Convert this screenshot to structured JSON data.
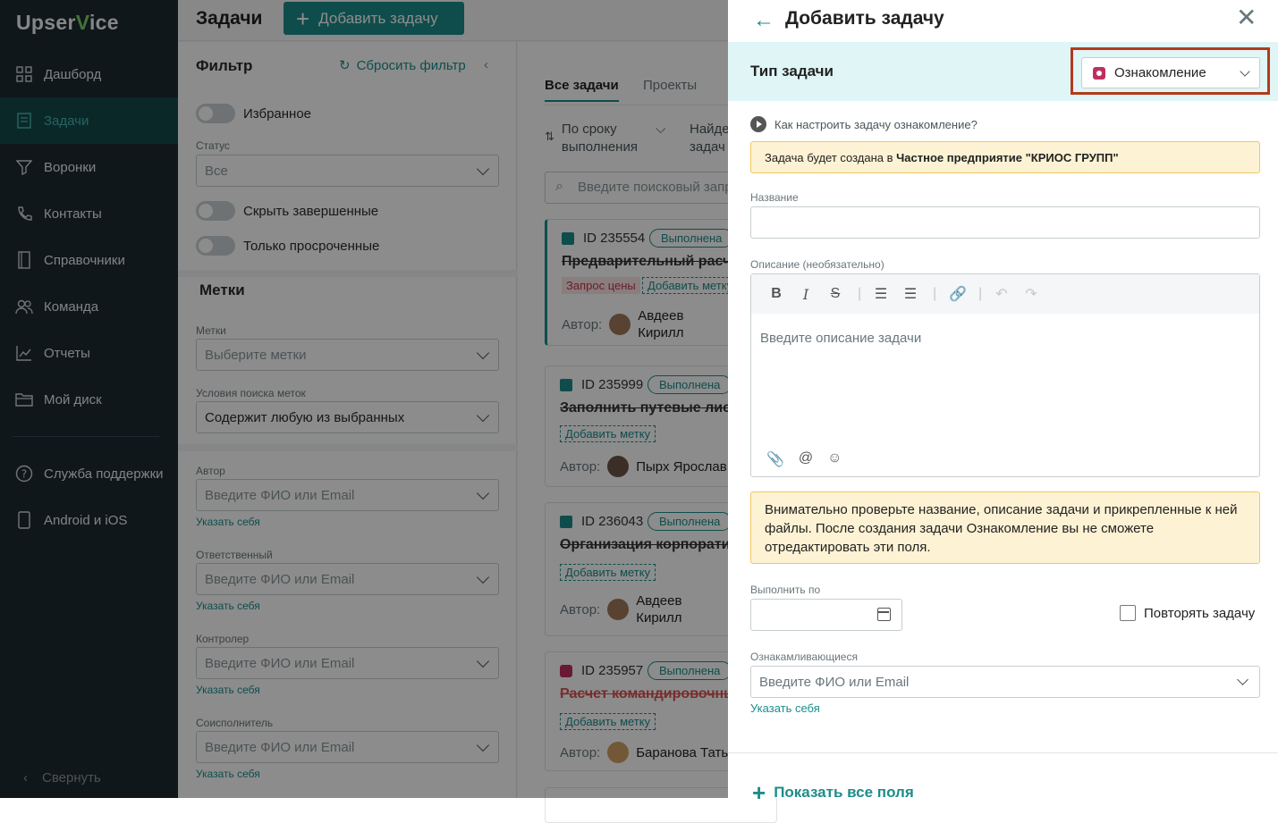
{
  "app": {
    "logo_pre": "Upser",
    "logo_v": "V",
    "logo_post": "ice"
  },
  "sidebar": {
    "items": [
      {
        "label": "Дашборд",
        "icon": "dashboard-icon"
      },
      {
        "label": "Задачи",
        "icon": "tasks-icon",
        "active": true
      },
      {
        "label": "Воронки",
        "icon": "funnel-icon"
      },
      {
        "label": "Контакты",
        "icon": "phone-icon"
      },
      {
        "label": "Справочники",
        "icon": "book-icon"
      },
      {
        "label": "Команда",
        "icon": "team-icon"
      },
      {
        "label": "Отчеты",
        "icon": "chart-icon"
      },
      {
        "label": "Мой диск",
        "icon": "folder-icon"
      }
    ],
    "support": "Служба поддержки",
    "mobile": "Android и iOS",
    "collapse": "Свернуть"
  },
  "header": {
    "title": "Задачи",
    "add_button": "Добавить задачу"
  },
  "filter": {
    "title": "Фильтр",
    "reset": "Сбросить фильтр",
    "favorites": "Избранное",
    "status_label": "Статус",
    "status_value": "Все",
    "hide_done": "Скрыть завершенные",
    "only_overdue": "Только просроченные",
    "tags_title": "Метки",
    "tags_label": "Метки",
    "tags_placeholder": "Выберите метки",
    "tag_search_label": "Условия поиска меток",
    "tag_search_value": "Содержит любую из выбранных",
    "author_label": "Автор",
    "responsible_label": "Ответственный",
    "controller_label": "Контролер",
    "coexec_label": "Соисполнитель",
    "person_placeholder": "Введите ФИО или Email",
    "self_link": "Указать себя"
  },
  "list": {
    "tabs": [
      "Все задачи",
      "Проекты"
    ],
    "sort_line1": "По сроку",
    "sort_line2": "выполнения",
    "find_line1": "Найде",
    "find_line2": "задач",
    "search_placeholder": "Введите поисковый запрос",
    "cards": [
      {
        "id": "ID 235554",
        "status": "Выполнена",
        "title": "Предварительный расчет",
        "tag": "Запрос цены",
        "add_tag": "Добавить метку",
        "author_label": "Автор:",
        "author": "Авдеев Кирилл"
      },
      {
        "id": "ID 235999",
        "status": "Выполнена",
        "title": "Заполнить путевые листы",
        "add_tag": "Добавить метку",
        "author_label": "Автор:",
        "author": "Пырх Ярослав"
      },
      {
        "id": "ID 236043",
        "status": "Выполнена",
        "title": "Организация корпоратива",
        "add_tag": "Добавить метку",
        "author_label": "Автор:",
        "author": "Авдеев Кирилл"
      },
      {
        "id": "ID 235957",
        "status": "Выполнена",
        "title": "Расчет командировочных",
        "add_tag": "Добавить метку",
        "author_label": "Автор:",
        "author": "Баранова Татьяна"
      }
    ]
  },
  "panel": {
    "title": "Добавить задачу",
    "type_label": "Тип задачи",
    "type_value": "Ознакомление",
    "howto": "Как настроить задачу ознакомление?",
    "info_prefix": "Задача будет создана в ",
    "info_company": "Частное предприятие \"КРИОС ГРУПП\"",
    "name_label": "Название",
    "desc_label": "Описание (необязательно)",
    "desc_placeholder": "Введите описание задачи",
    "warning": "Внимательно проверьте название, описание задачи и прикрепленные к ней файлы. После создания задачи Ознакомление вы не сможете отредактировать эти поля.",
    "due_label": "Выполнить по",
    "repeat": "Повторять задачу",
    "readers_label": "Ознакамливающиеся",
    "readers_placeholder": "Введите ФИО или Email",
    "self_link": "Указать себя",
    "show_all": "Показать все поля"
  },
  "colors": {
    "accent": "#1c8d8a",
    "highlight_frame": "#b33a1c",
    "sidebar_bg": "#1e2a30"
  }
}
